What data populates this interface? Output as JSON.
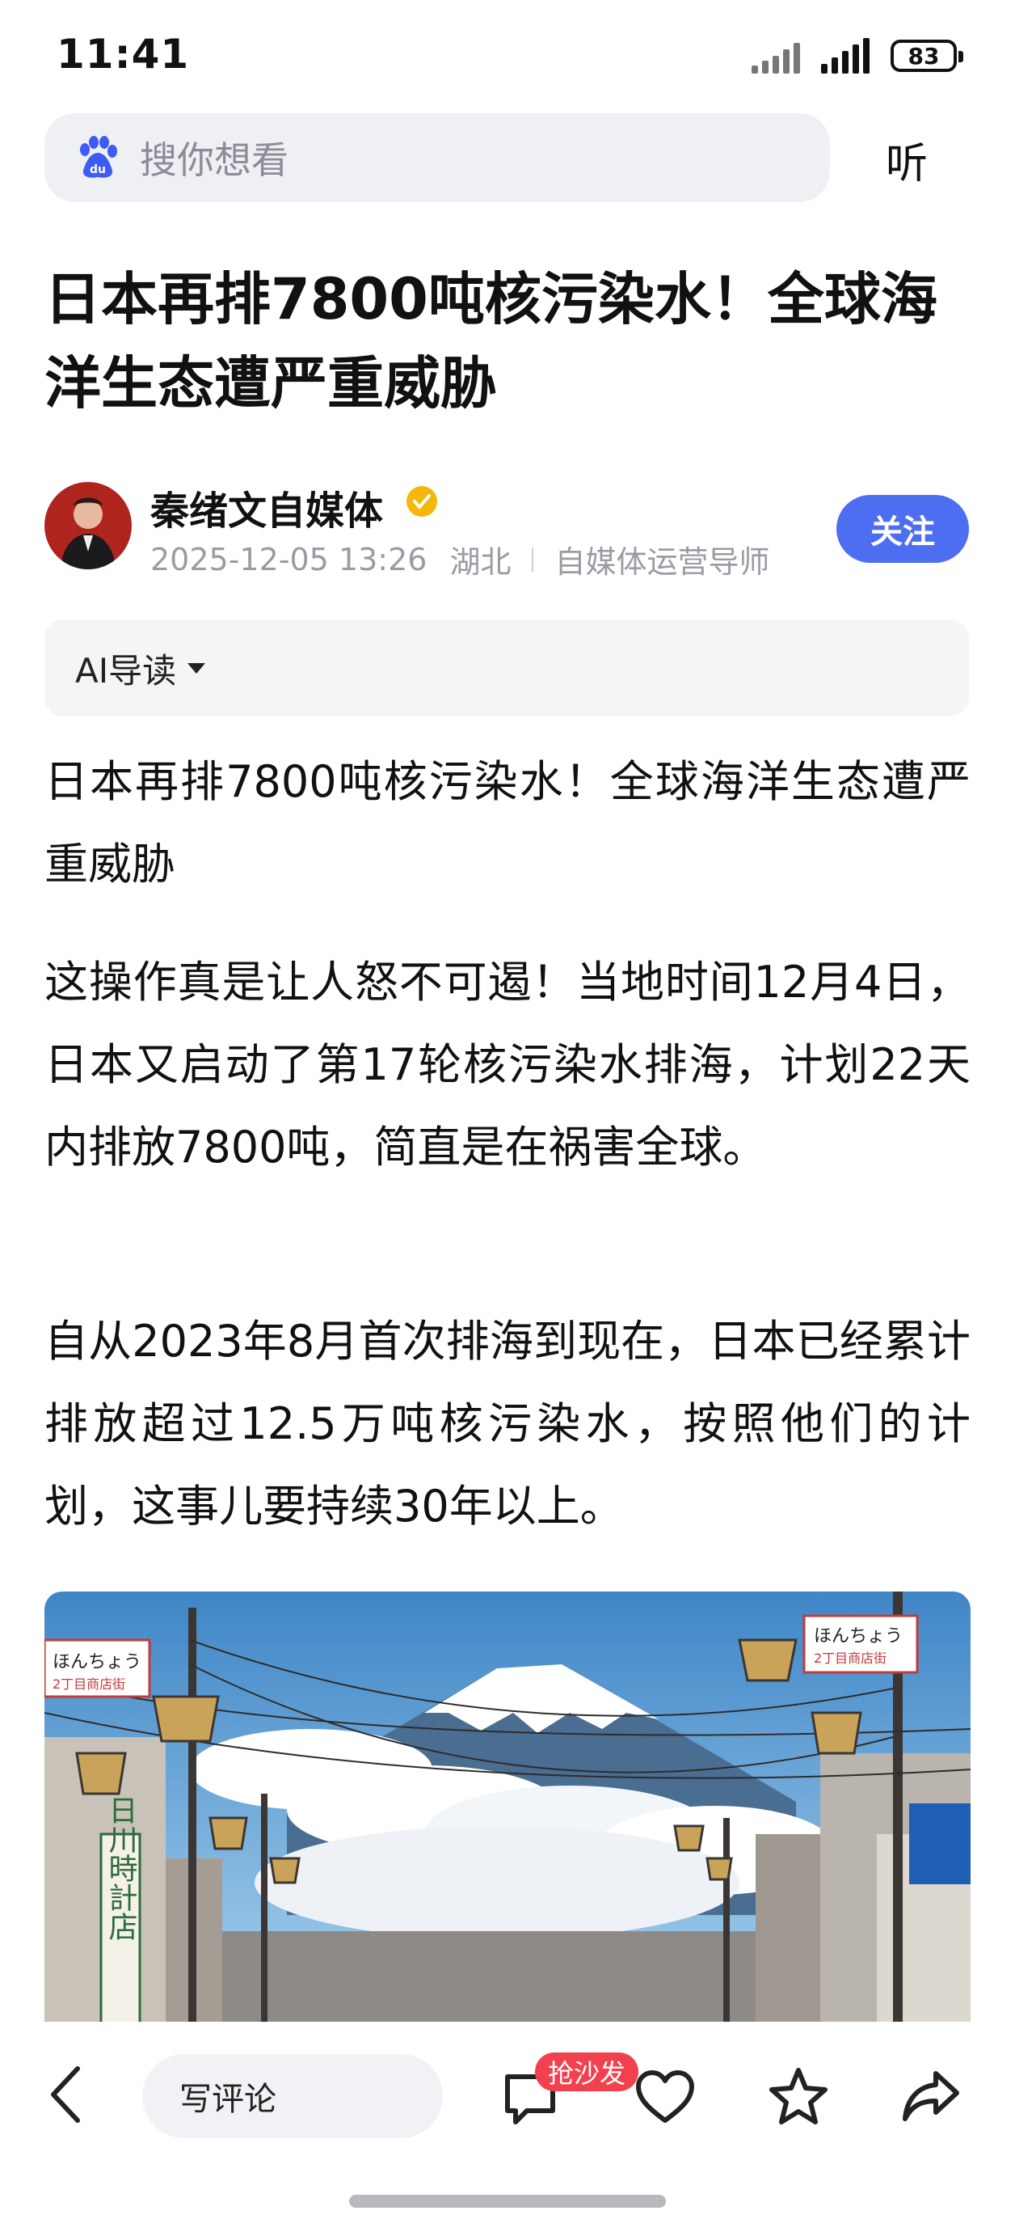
{
  "status_bar": {
    "time": "11:41",
    "battery": "83"
  },
  "search": {
    "placeholder": "搜你想看",
    "listen_label": "听"
  },
  "article": {
    "title": "日本再排7800吨核污染水！全球海洋生态遭严重威胁",
    "author": {
      "name": "秦绪文自媒体",
      "date": "2025-12-05 13:26",
      "location": "湖北",
      "role": "自媒体运营导师",
      "follow_label": "关注"
    },
    "ai_guide_label": "AI导读",
    "paragraphs": [
      "日本再排7800吨核污染水！全球海洋生态遭严重威胁",
      "这操作真是让人怒不可遏！当地时间12月4日，日本又启动了第17轮核污染水排海，计划22天内排放7800吨，简直是在祸害全球。",
      "自从2023年8月首次排海到现在，日本已经累计排放超过12.5万吨核污染水，按照他们的计划，这事儿要持续30年以上。"
    ],
    "image": {
      "left_sign": "ほんちょう",
      "left_sign_sub": "2丁目商店街",
      "right_sign": "ほんちょう",
      "right_sign_sub": "2丁目商店街",
      "vertical_sign": "日川時計店"
    }
  },
  "bottom_bar": {
    "comment_placeholder": "写评论",
    "sofa_badge": "抢沙发"
  },
  "icons": [
    "baidu-paw-icon",
    "verified-icon",
    "back-icon",
    "comment-icon",
    "heart-icon",
    "star-icon",
    "share-icon"
  ],
  "colors": {
    "accent": "#4e6ef2",
    "badge": "#f2414e",
    "verified": "#f5b70a"
  }
}
